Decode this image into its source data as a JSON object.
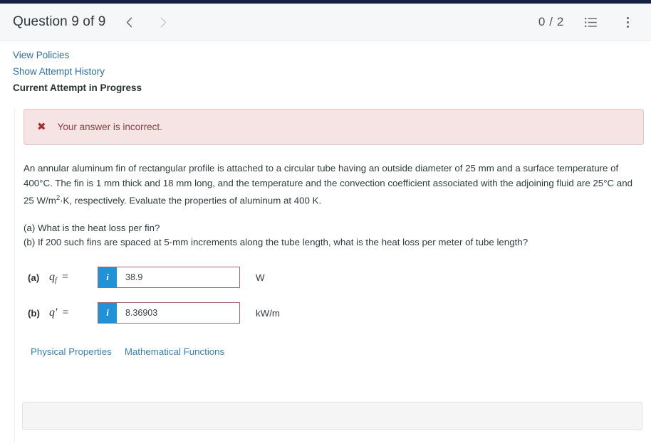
{
  "header": {
    "title": "Question 9 of 9",
    "prev_icon": "chevron-left-icon",
    "next_icon": "chevron-right-icon",
    "score": "0 / 2",
    "list_icon": "list-icon",
    "menu_icon": "kebab-menu-icon"
  },
  "links": {
    "view_policies": "View Policies",
    "show_attempt_history": "Show Attempt History",
    "current_attempt": "Current Attempt in Progress"
  },
  "alert": {
    "icon": "x-mark-icon",
    "icon_glyph": "✖",
    "text": "Your answer is incorrect.",
    "bg_color": "#f6e3e3",
    "border_color": "#e5c4c4",
    "icon_color": "#a32f2f",
    "text_color": "#8d4040"
  },
  "problem": {
    "paragraph_part1": "An annular aluminum fin of rectangular profile is attached to a circular tube having an outside diameter of 25 mm and a surface temperature of 400°C. The fin is 1 mm thick and 18 mm long, and the temperature and the convection coefficient associated with the adjoining fluid are 25°C and 25 W/m",
    "paragraph_sup": "2",
    "paragraph_part2": "·K, respectively. Evaluate the properties of aluminum at 400 K.",
    "part_a": "(a) What is the heat loss per fin?",
    "part_b": "(b) If 200 such fins are spaced at 5-mm increments along the tube length, what is the heat loss per meter of tube length?"
  },
  "answers": [
    {
      "tag": "(a)",
      "symbol": "q",
      "subscript": "f",
      "prime": "",
      "equals": "=",
      "info_label": "i",
      "value": "38.9",
      "placeholder": "",
      "unit": "W"
    },
    {
      "tag": "(b)",
      "symbol": "q",
      "subscript": "",
      "prime": "′",
      "equals": "=",
      "info_label": "i",
      "value": "8.36903",
      "placeholder": "",
      "unit": "kW/m"
    }
  ],
  "tool_links": [
    {
      "label": "Physical Properties"
    },
    {
      "label": "Mathematical Functions"
    }
  ],
  "colors": {
    "top_strip": "#16213f",
    "link_blue": "#2f6fa8",
    "info_button_blue": "#2092d8",
    "input_border_error": "#9c6a6a"
  }
}
